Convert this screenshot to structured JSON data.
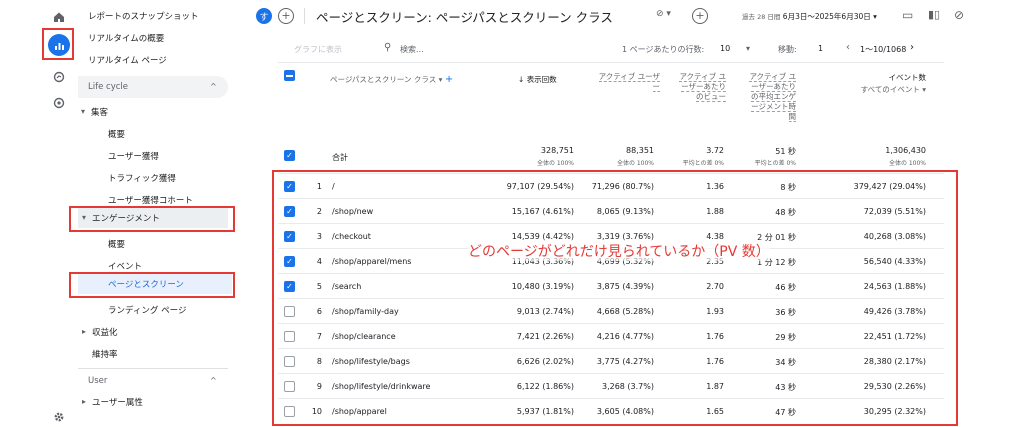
{
  "rail": {
    "icons": [
      "home-icon",
      "reports-icon",
      "explore-icon",
      "advertising-icon",
      "settings-icon"
    ]
  },
  "sidebar": {
    "items": [
      {
        "label": "レポートのスナップショット"
      },
      {
        "label": "リアルタイムの概要"
      },
      {
        "label": "リアルタイム ページ"
      }
    ],
    "section_lifecycle": "Life cycle",
    "acquisition": "集客",
    "acquisition_items": [
      "概要",
      "ユーザー獲得",
      "トラフィック獲得",
      "ユーザー獲得コホート"
    ],
    "engagement": "エンゲージメント",
    "engagement_items": [
      "概要",
      "イベント",
      "ページとスクリーン",
      "ランディング ページ"
    ],
    "monetization": "収益化",
    "retention": "維持率",
    "section_user": "User",
    "user_attributes": "ユーザー属性"
  },
  "header": {
    "badge": "す",
    "title": "ページとスクリーン: ページパスとスクリーン クラス",
    "date_prefix": "過去 28 日間",
    "date_range": "6月3日～2025年6月30日"
  },
  "toolbar": {
    "chart_button": "グラフに表示",
    "search_placeholder": "検索...",
    "rows_per_page_label": "1 ページあたりの行数:",
    "rows_per_page": "10",
    "goto_label": "移動:",
    "goto_value": "1",
    "pagination": "1～10/1068"
  },
  "table": {
    "dimension_header": "ページパスとスクリーン クラス",
    "columns": [
      "表示回数",
      "アクティブ ユーザー",
      "アクティブ ユーザーあたりのビュー",
      "アクティブ ユーザーあたりの平均エンゲージメント時間",
      "イベント数"
    ],
    "events_sub": "すべてのイベント",
    "total_label": "合計",
    "totals": [
      "328,751",
      "88,351",
      "3.72",
      "51 秒",
      "1,306,430"
    ],
    "totals_sub": [
      "全体の 100%",
      "全体の 100%",
      "平均との差 0%",
      "平均との差 0%",
      "全体の 100%"
    ],
    "rows": [
      {
        "n": "1",
        "path": "/",
        "views": "97,107 (29.54%)",
        "users": "71,296 (80.7%)",
        "vpu": "1.36",
        "time": "8 秒",
        "events": "379,427 (29.04%)",
        "checked": true
      },
      {
        "n": "2",
        "path": "/shop/new",
        "views": "15,167 (4.61%)",
        "users": "8,065 (9.13%)",
        "vpu": "1.88",
        "time": "48 秒",
        "events": "72,039 (5.51%)",
        "checked": true
      },
      {
        "n": "3",
        "path": "/checkout",
        "views": "14,539 (4.42%)",
        "users": "3,319 (3.76%)",
        "vpu": "4.38",
        "time": "2 分 01 秒",
        "events": "40,268 (3.08%)",
        "checked": true
      },
      {
        "n": "4",
        "path": "/shop/apparel/mens",
        "views": "11,043 (3.36%)",
        "users": "4,699 (5.32%)",
        "vpu": "2.35",
        "time": "1 分 12 秒",
        "events": "56,540 (4.33%)",
        "checked": true
      },
      {
        "n": "5",
        "path": "/search",
        "views": "10,480 (3.19%)",
        "users": "3,875 (4.39%)",
        "vpu": "2.70",
        "time": "46 秒",
        "events": "24,563 (1.88%)",
        "checked": true
      },
      {
        "n": "6",
        "path": "/shop/family-day",
        "views": "9,013 (2.74%)",
        "users": "4,668 (5.28%)",
        "vpu": "1.93",
        "time": "36 秒",
        "events": "49,426 (3.78%)",
        "checked": false
      },
      {
        "n": "7",
        "path": "/shop/clearance",
        "views": "7,421 (2.26%)",
        "users": "4,216 (4.77%)",
        "vpu": "1.76",
        "time": "29 秒",
        "events": "22,451 (1.72%)",
        "checked": false
      },
      {
        "n": "8",
        "path": "/shop/lifestyle/bags",
        "views": "6,626 (2.02%)",
        "users": "3,775 (4.27%)",
        "vpu": "1.76",
        "time": "34 秒",
        "events": "28,380 (2.17%)",
        "checked": false
      },
      {
        "n": "9",
        "path": "/shop/lifestyle/drinkware",
        "views": "6,122 (1.86%)",
        "users": "3,268 (3.7%)",
        "vpu": "1.87",
        "time": "43 秒",
        "events": "29,530 (2.26%)",
        "checked": false
      },
      {
        "n": "10",
        "path": "/shop/apparel",
        "views": "5,937 (1.81%)",
        "users": "3,605 (4.08%)",
        "vpu": "1.65",
        "time": "47 秒",
        "events": "30,295 (2.32%)",
        "checked": false
      }
    ]
  },
  "annotation": "どのページがどれだけ見られているか（PV 数）",
  "colors": {
    "accent": "#1a73e8",
    "highlight": "#e53935"
  }
}
